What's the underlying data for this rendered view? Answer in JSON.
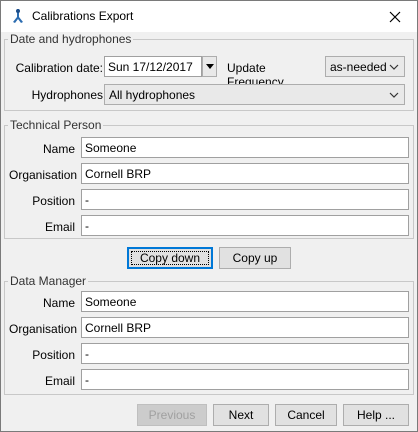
{
  "window": {
    "title": "Calibrations Export"
  },
  "icons": {
    "app": "hydrophone-app-icon",
    "close": "close-icon",
    "dropdown": "chevron-down-icon"
  },
  "date_group": {
    "legend": "Date and hydrophones",
    "calibration_date_label": "Calibration date:",
    "calibration_date_value": "Sun 17/12/2017",
    "update_frequency_label": "Update Frequency",
    "update_frequency_value": "as-needed",
    "hydrophones_label": "Hydrophones",
    "hydrophones_value": "All hydrophones"
  },
  "technical_person": {
    "legend": "Technical Person",
    "name_label": "Name",
    "name_value": "Someone",
    "organisation_label": "Organisation",
    "organisation_value": "Cornell BRP",
    "position_label": "Position",
    "position_value": "-",
    "email_label": "Email",
    "email_value": "-"
  },
  "copy_buttons": {
    "copy_down": "Copy down",
    "copy_up": "Copy up"
  },
  "data_manager": {
    "legend": "Data Manager",
    "name_label": "Name",
    "name_value": "Someone",
    "organisation_label": "Organisation",
    "organisation_value": "Cornell BRP",
    "position_label": "Position",
    "position_value": "-",
    "email_label": "Email",
    "email_value": "-"
  },
  "footer": {
    "previous": "Previous",
    "next": "Next",
    "cancel": "Cancel",
    "help": "Help ..."
  }
}
